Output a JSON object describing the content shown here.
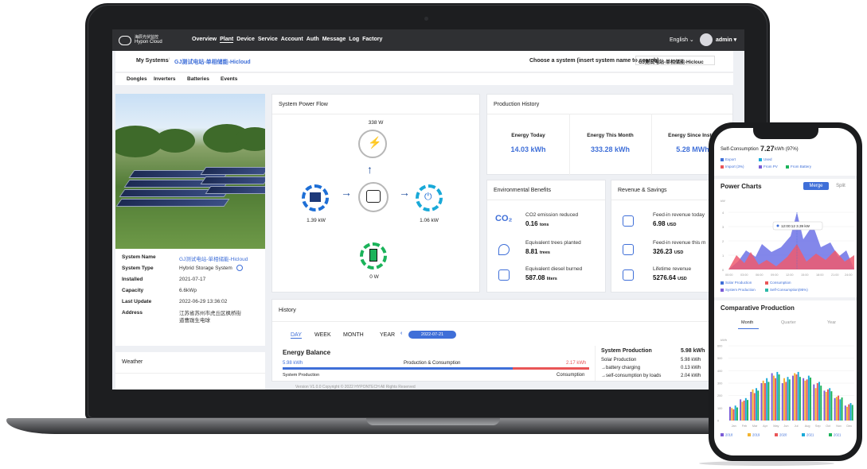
{
  "nav": {
    "brand_cn": "海辰光伏监控",
    "brand": "Hypon Cloud",
    "items": [
      "Overview",
      "Plant",
      "Device",
      "Service",
      "Account",
      "Auth",
      "Message",
      "Log",
      "Factory"
    ],
    "active": "Plant",
    "language": "English",
    "user": "admin"
  },
  "breadcrumb": {
    "root": "My Systems",
    "separator": "/",
    "current": "GJ测试电站-单相储能-Hicloud",
    "choose_label": "Choose a system (insert system name to search)",
    "choose_value": "GJ测试电站-单相储能-Hiclouc"
  },
  "subtabs": [
    "Dongles",
    "Inverters",
    "Batteries",
    "Events"
  ],
  "system_info": {
    "rows": [
      {
        "key": "System Name",
        "value": "GJ测试电站-单相储能-Hicloud"
      },
      {
        "key": "System Type",
        "value": "Hybrid Storage System"
      },
      {
        "key": "Installed",
        "value": "2021-07-17"
      },
      {
        "key": "Capacity",
        "value": "6.6kWp"
      },
      {
        "key": "Last Update",
        "value": "2022-06-29 13:36:02"
      },
      {
        "key": "Address",
        "value": "江苏省苏州市虎丘区枫桥街道曹跋生电球"
      }
    ]
  },
  "weather": {
    "title": "Weather"
  },
  "power_flow": {
    "title": "System Power Flow",
    "grid": "338 W",
    "solar": "1.39 kW",
    "load": "1.06 kW",
    "battery": "0 W"
  },
  "production": {
    "title": "Production History",
    "stats": [
      {
        "label": "Energy Today",
        "value": "14.03 kWh"
      },
      {
        "label": "Energy This Month",
        "value": "333.28 kWh"
      },
      {
        "label": "Energy Since Install",
        "value": "5.28 MWh"
      }
    ]
  },
  "environment": {
    "title": "Environmental Benefits",
    "items": [
      {
        "label": "CO2 emission reduced",
        "value": "0.16",
        "unit": "tons"
      },
      {
        "label": "Equivalent trees planted",
        "value": "8.81",
        "unit": "trees"
      },
      {
        "label": "Equivalent diesel burned",
        "value": "587.08",
        "unit": "liters"
      }
    ]
  },
  "revenue": {
    "title": "Revenue & Savings",
    "items": [
      {
        "label": "Feed-in revenue today",
        "value": "6.98",
        "unit": "USD"
      },
      {
        "label": "Feed-in revenue this m",
        "value": "326.23",
        "unit": "USD"
      },
      {
        "label": "Lifetime revenue",
        "value": "5276.64",
        "unit": "USD"
      }
    ]
  },
  "history": {
    "title": "History",
    "tabs": [
      "DAY",
      "WEEK",
      "MONTH",
      "YEAR"
    ],
    "date": "2022-07-21",
    "balance_title": "Energy Balance",
    "left_value": "5.98 kWh",
    "mid_label": "Production & Consumption",
    "right_value": "2.17 kWh",
    "left_caption": "System Production",
    "right_caption": "Consumption",
    "prod_title": "System Production",
    "prod_total": "5.98 kWh",
    "prod_rows": [
      {
        "label": "Solar Production",
        "value": "5.98 kWh"
      },
      {
        "label": "→battery charging",
        "value": "0.13 kWh"
      },
      {
        "label": "→self-consumption by loads",
        "value": "2.04 kWh"
      }
    ]
  },
  "footer": "Version V1.0.0   Copyright © 2022 HYPONTECH All Rights Reserved",
  "phone": {
    "self_consumption_label": "Self-Consumption",
    "self_consumption_value": "7.27",
    "self_consumption_unit": "kWh (97%)",
    "legend_top": [
      "Export",
      "Used",
      "Import (3%)",
      "From PV",
      "From Battery"
    ],
    "power_title": "Power Charts",
    "merge": "Merge",
    "split": "Split",
    "unit": "kW",
    "tooltip": "12:00:12 3.39 kW",
    "power_x": [
      "00:00",
      "03:00",
      "06:00",
      "09:00",
      "12:00",
      "15:00",
      "18:00",
      "21:00",
      "24:00"
    ],
    "power_y": [
      "4",
      "3",
      "2",
      "1",
      "0"
    ],
    "legend_mid": [
      "Solar Production",
      "Consumption",
      "System Production",
      "Self-Consumption(95%)"
    ],
    "comp_title": "Comparative Production",
    "comp_tabs": [
      "Month",
      "Quarter",
      "Year"
    ],
    "comp_unit": "kWh",
    "comp_y": [
      "600",
      "500",
      "400",
      "300",
      "200",
      "100",
      "0"
    ],
    "comp_x": [
      "Jan",
      "Feb",
      "Mar",
      "Apr",
      "May",
      "Jun",
      "Jul",
      "Aug",
      "Sep",
      "Oct",
      "Nov",
      "Dec"
    ],
    "comp_legend": [
      "2018",
      "2019",
      "2020",
      "2021",
      "2021"
    ]
  },
  "colors": {
    "accent": "#3f6fd8",
    "nav_bg": "#2f3033",
    "red": "#e95557",
    "green": "#1bb35a",
    "yellow": "#f2b430",
    "cyan": "#19a9d8"
  },
  "chart_data": {
    "type": "bar",
    "categories": [
      "Jan",
      "Feb",
      "Mar",
      "Apr",
      "May",
      "Jun",
      "Jul",
      "Aug",
      "Sep",
      "Oct",
      "Nov",
      "Dec"
    ],
    "series": [
      {
        "name": "2018",
        "values": [
          110,
          170,
          230,
          300,
          380,
          300,
          360,
          340,
          290,
          240,
          180,
          120
        ]
      },
      {
        "name": "2019",
        "values": [
          100,
          150,
          250,
          320,
          360,
          340,
          380,
          320,
          260,
          230,
          190,
          110
        ]
      },
      {
        "name": "2020",
        "values": [
          90,
          160,
          220,
          300,
          340,
          310,
          370,
          330,
          300,
          250,
          200,
          130
        ]
      },
      {
        "name": "2021",
        "values": [
          120,
          180,
          260,
          340,
          390,
          350,
          390,
          360,
          310,
          260,
          170,
          140
        ]
      },
      {
        "name": "2021",
        "values": [
          105,
          165,
          240,
          310,
          370,
          330,
          350,
          345,
          280,
          235,
          185,
          125
        ]
      }
    ],
    "ylim": [
      0,
      600
    ],
    "ylabel": "kWh"
  }
}
